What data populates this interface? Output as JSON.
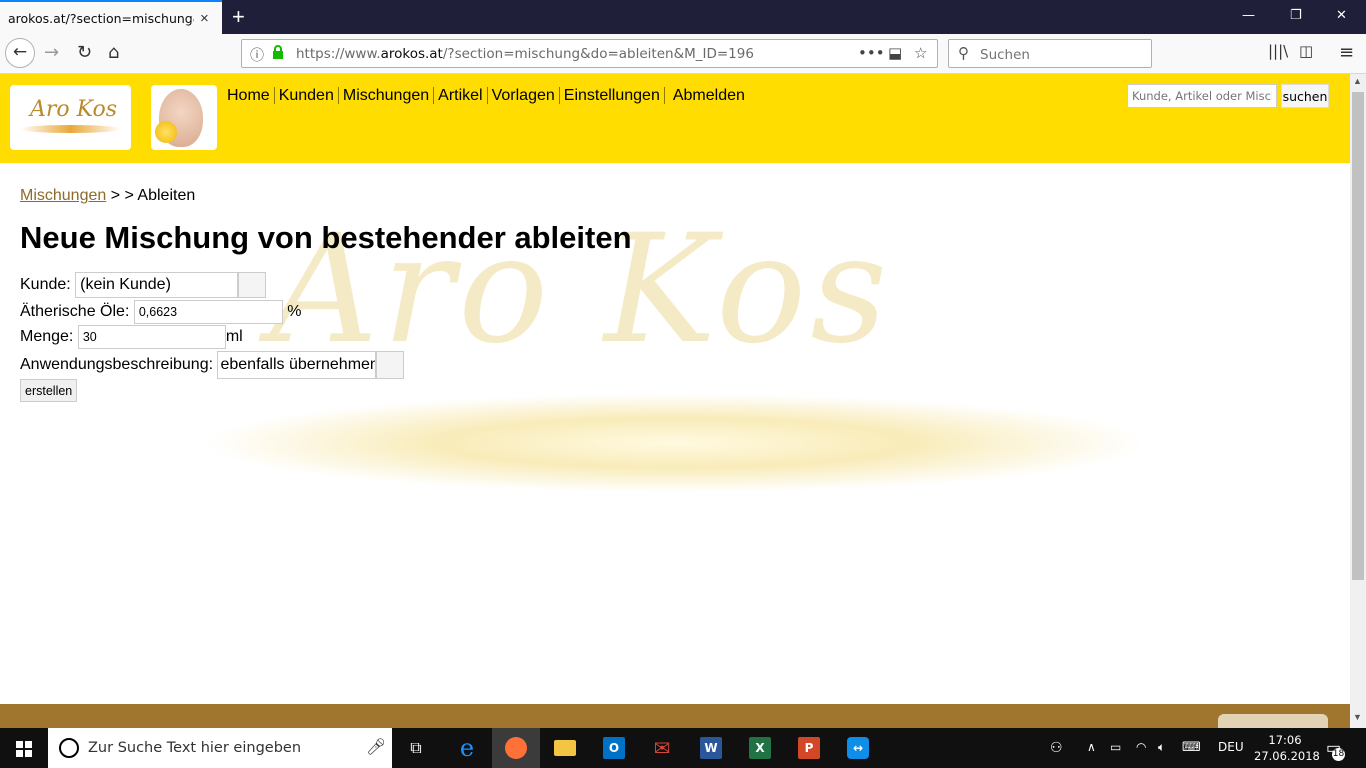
{
  "browser": {
    "tab_title": "arokos.at/?section=mischung&do=",
    "tab_close": "×",
    "new_tab": "+",
    "url_prefix": "https://www.",
    "url_host": "arokos.at",
    "url_rest": "/?section=mischung&do=ableiten&M_ID=196",
    "search_placeholder": "Suchen",
    "window_minimize": "—",
    "window_restore": "❐",
    "window_close": "✕"
  },
  "site": {
    "logo_text": "Aro Kos",
    "nav": [
      "Home",
      "Kunden",
      "Mischungen",
      "Artikel",
      "Vorlagen",
      "Einstellungen",
      "Abmelden"
    ],
    "search_placeholder": "Kunde, Artikel oder Mischung",
    "search_button": "suchen",
    "watermark": "Aro Kos",
    "accent_color": "#ffdd00",
    "footer_color": "#a0762e"
  },
  "breadcrumb": {
    "link": "Mischungen",
    "separator": " > > ",
    "current": "Ableiten"
  },
  "page_title": "Neue Mischung von bestehender ableiten",
  "form": {
    "kunde_label": "Kunde:",
    "kunde_value": "(kein Kunde)",
    "oele_label": "Ätherische Öle:",
    "oele_value": "0,6623",
    "oele_unit": "%",
    "menge_label": "Menge:",
    "menge_value": "30",
    "menge_unit": "ml",
    "anwendung_label": "Anwendungsbeschreibung:",
    "anwendung_value": "ebenfalls übernehmen",
    "submit": "erstellen"
  },
  "taskbar": {
    "search_placeholder": "Zur Suche Text hier eingeben",
    "language": "DEU",
    "time": "17:06",
    "date": "27.06.2018",
    "notification_count": "18"
  }
}
